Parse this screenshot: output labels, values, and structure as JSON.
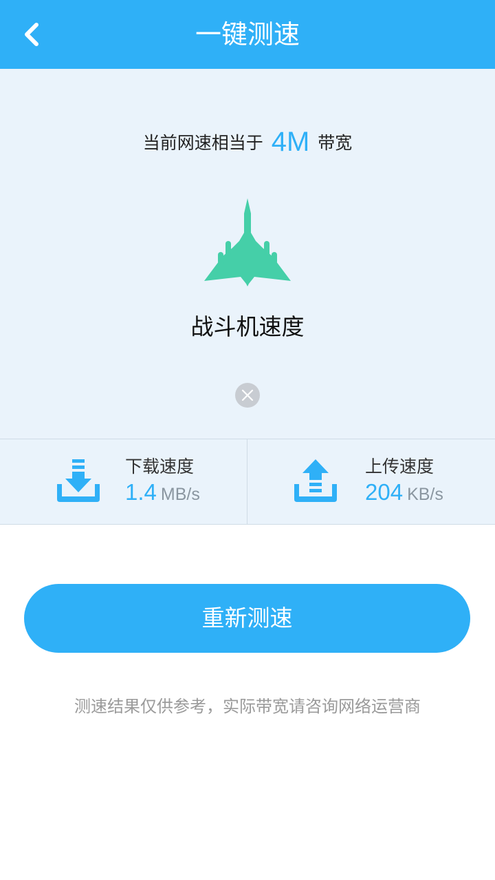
{
  "header": {
    "title": "一键测速",
    "back_icon": "chevron-left-icon"
  },
  "result": {
    "prefix": "当前网速相当于",
    "bandwidth": "4M",
    "suffix": "带宽",
    "level_icon": "fighter-jet-icon",
    "level_label": "战斗机速度",
    "close_icon": "close-icon"
  },
  "stats": {
    "download": {
      "label": "下载速度",
      "value": "1.4",
      "unit": "MB/s",
      "icon": "download-icon"
    },
    "upload": {
      "label": "上传速度",
      "value": "204",
      "unit": "KB/s",
      "icon": "upload-icon"
    }
  },
  "actions": {
    "retest_label": "重新测速"
  },
  "disclaimer": "测速结果仅供参考，实际带宽请咨询网络运营商",
  "colors": {
    "primary": "#2fb0f7",
    "plane": "#45cfa8",
    "hero_bg": "#eaf3fb"
  }
}
